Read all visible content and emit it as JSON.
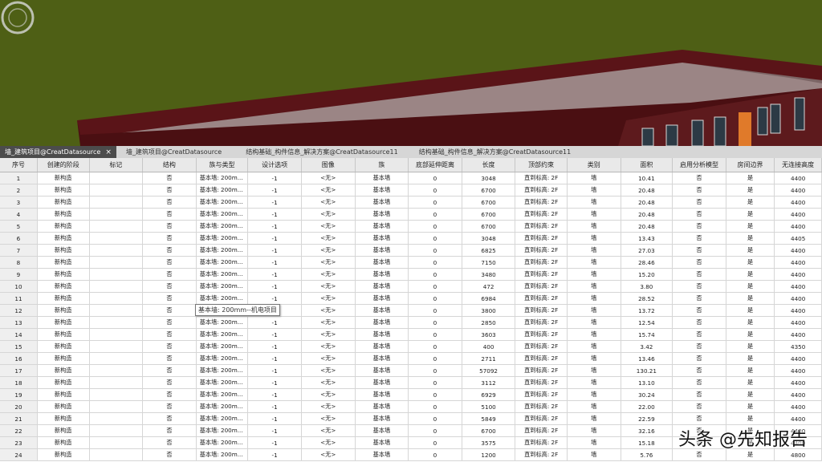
{
  "colors": {
    "viewport_bg": "#4e5f15",
    "building_wall": "#5a1418",
    "roof": "#8c6e6e",
    "active_tab_bg": "#4c4c4c"
  },
  "viewport": {
    "compass_icon": "navigation-wheel-icon"
  },
  "tabs": [
    {
      "label": "墙_建筑项目@CreatDatasource",
      "close": "×",
      "active": true
    },
    {
      "label": "墙_建筑项目@CreatDatasource",
      "active": false
    },
    {
      "label": "结构基础_构件信息_解决方案@CreatDatasource11",
      "active": false
    },
    {
      "label": "结构基础_构件信息_解决方案@CreatDatasource11",
      "active": false
    }
  ],
  "table": {
    "headers": [
      "序号",
      "创建的阶段",
      "标记",
      "结构",
      "族与类型",
      "设计选项",
      "图像",
      "族",
      "底部延伸距离",
      "长度",
      "顶部约束",
      "类别",
      "面积",
      "启用分析模型",
      "房间边界",
      "无连接高度"
    ],
    "rows": [
      [
        "1",
        "新构造",
        "",
        "否",
        "基本墙: 200m...",
        "-1",
        "<无>",
        "基本墙",
        "0",
        "3048",
        "直到标高: 2F",
        "墙",
        "10.41",
        "否",
        "是",
        "4400"
      ],
      [
        "2",
        "新构造",
        "",
        "否",
        "基本墙: 200m...",
        "-1",
        "<无>",
        "基本墙",
        "0",
        "6700",
        "直到标高: 2F",
        "墙",
        "20.48",
        "否",
        "是",
        "4400"
      ],
      [
        "3",
        "新构造",
        "",
        "否",
        "基本墙: 200m...",
        "-1",
        "<无>",
        "基本墙",
        "0",
        "6700",
        "直到标高: 2F",
        "墙",
        "20.48",
        "否",
        "是",
        "4400"
      ],
      [
        "4",
        "新构造",
        "",
        "否",
        "基本墙: 200m...",
        "-1",
        "<无>",
        "基本墙",
        "0",
        "6700",
        "直到标高: 2F",
        "墙",
        "20.48",
        "否",
        "是",
        "4400"
      ],
      [
        "5",
        "新构造",
        "",
        "否",
        "基本墙: 200m...",
        "-1",
        "<无>",
        "基本墙",
        "0",
        "6700",
        "直到标高: 2F",
        "墙",
        "20.48",
        "否",
        "是",
        "4400"
      ],
      [
        "6",
        "新构造",
        "",
        "否",
        "基本墙: 200m...",
        "-1",
        "<无>",
        "基本墙",
        "0",
        "3048",
        "直到标高: 2F",
        "墙",
        "13.43",
        "否",
        "是",
        "4405"
      ],
      [
        "7",
        "新构造",
        "",
        "否",
        "基本墙: 200m...",
        "-1",
        "<无>",
        "基本墙",
        "0",
        "6825",
        "直到标高: 2F",
        "墙",
        "27.03",
        "否",
        "是",
        "4400"
      ],
      [
        "8",
        "新构造",
        "",
        "否",
        "基本墙: 200m...",
        "-1",
        "<无>",
        "基本墙",
        "0",
        "7150",
        "直到标高: 2F",
        "墙",
        "28.46",
        "否",
        "是",
        "4400"
      ],
      [
        "9",
        "新构造",
        "",
        "否",
        "基本墙: 200m...",
        "-1",
        "<无>",
        "基本墙",
        "0",
        "3480",
        "直到标高: 2F",
        "墙",
        "15.20",
        "否",
        "是",
        "4400"
      ],
      [
        "10",
        "新构造",
        "",
        "否",
        "基本墙: 200m...",
        "-1",
        "<无>",
        "基本墙",
        "0",
        "472",
        "直到标高: 2F",
        "墙",
        "3.80",
        "否",
        "是",
        "4400"
      ],
      [
        "11",
        "新构造",
        "",
        "否",
        "基本墙: 200m...",
        "-1",
        "<无>",
        "基本墙",
        "0",
        "6984",
        "直到标高: 2F",
        "墙",
        "28.52",
        "否",
        "是",
        "4400"
      ],
      [
        "12",
        "新构造",
        "",
        "否",
        "",
        "-1",
        "<无>",
        "基本墙",
        "0",
        "3800",
        "直到标高: 2F",
        "墙",
        "13.72",
        "否",
        "是",
        "4400"
      ],
      [
        "13",
        "新构造",
        "",
        "否",
        "基本墙: 200m...",
        "-1",
        "<无>",
        "基本墙",
        "0",
        "2850",
        "直到标高: 2F",
        "墙",
        "12.54",
        "否",
        "是",
        "4400"
      ],
      [
        "14",
        "新构造",
        "",
        "否",
        "基本墙: 200m...",
        "-1",
        "<无>",
        "基本墙",
        "0",
        "3603",
        "直到标高: 2F",
        "墙",
        "15.74",
        "否",
        "是",
        "4400"
      ],
      [
        "15",
        "新构造",
        "",
        "否",
        "基本墙: 200m...",
        "-1",
        "<无>",
        "基本墙",
        "0",
        "400",
        "直到标高: 2F",
        "墙",
        "3.42",
        "否",
        "是",
        "4350"
      ],
      [
        "16",
        "新构造",
        "",
        "否",
        "基本墙: 200m...",
        "-1",
        "<无>",
        "基本墙",
        "0",
        "2711",
        "直到标高: 2F",
        "墙",
        "13.46",
        "否",
        "是",
        "4400"
      ],
      [
        "17",
        "新构造",
        "",
        "否",
        "基本墙: 200m...",
        "-1",
        "<无>",
        "基本墙",
        "0",
        "57092",
        "直到标高: 2F",
        "墙",
        "130.21",
        "否",
        "是",
        "4400"
      ],
      [
        "18",
        "新构造",
        "",
        "否",
        "基本墙: 200m...",
        "-1",
        "<无>",
        "基本墙",
        "0",
        "3112",
        "直到标高: 2F",
        "墙",
        "13.10",
        "否",
        "是",
        "4400"
      ],
      [
        "19",
        "新构造",
        "",
        "否",
        "基本墙: 200m...",
        "-1",
        "<无>",
        "基本墙",
        "0",
        "6929",
        "直到标高: 2F",
        "墙",
        "30.24",
        "否",
        "是",
        "4400"
      ],
      [
        "20",
        "新构造",
        "",
        "否",
        "基本墙: 200m...",
        "-1",
        "<无>",
        "基本墙",
        "0",
        "5100",
        "直到标高: 2F",
        "墙",
        "22.00",
        "否",
        "是",
        "4400"
      ],
      [
        "21",
        "新构造",
        "",
        "否",
        "基本墙: 200m...",
        "-1",
        "<无>",
        "基本墙",
        "0",
        "5849",
        "直到标高: 2F",
        "墙",
        "22.59",
        "否",
        "是",
        "4400"
      ],
      [
        "22",
        "新构造",
        "",
        "否",
        "基本墙: 200m...",
        "-1",
        "<无>",
        "基本墙",
        "0",
        "6700",
        "直到标高: 2F",
        "墙",
        "32.16",
        "否",
        "是",
        "4400"
      ],
      [
        "23",
        "新构造",
        "",
        "否",
        "基本墙: 200m...",
        "-1",
        "<无>",
        "基本墙",
        "0",
        "3575",
        "直到标高: 2F",
        "墙",
        "15.18",
        "否",
        "是",
        "4400"
      ],
      [
        "24",
        "新构造",
        "",
        "否",
        "基本墙: 200m...",
        "-1",
        "<无>",
        "基本墙",
        "0",
        "1200",
        "直到标高: 2F",
        "墙",
        "5.76",
        "否",
        "是",
        "4800"
      ]
    ]
  },
  "tooltip": {
    "text": "基本墙: 200mm--机电项目"
  },
  "watermark": {
    "text": "头条 @先知报告"
  }
}
